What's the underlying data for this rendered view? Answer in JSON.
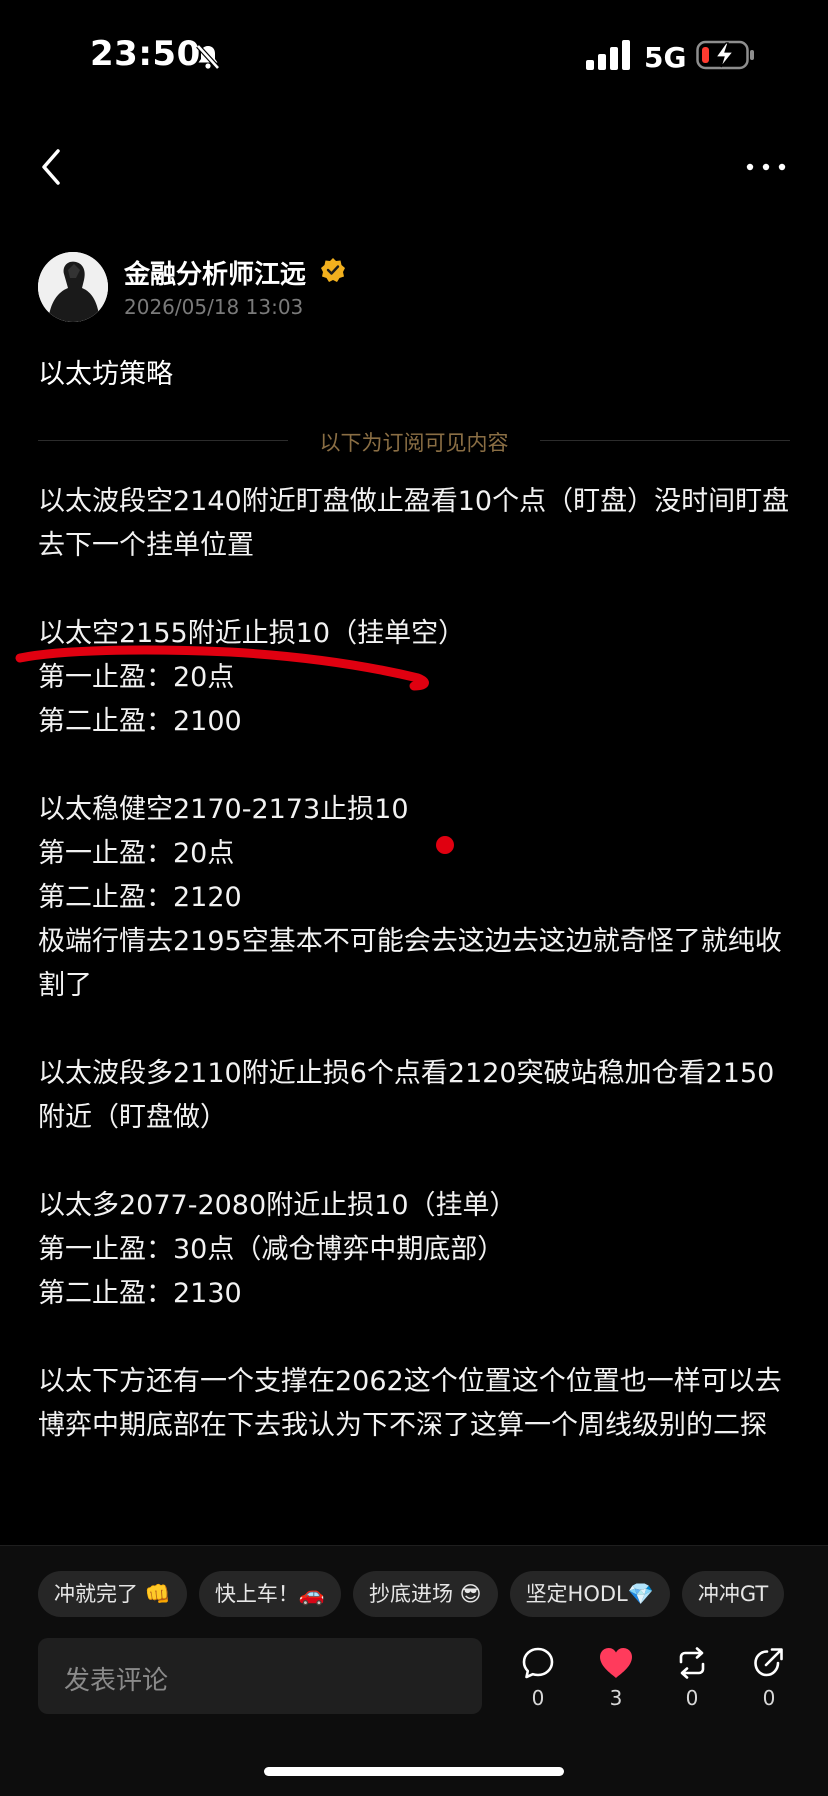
{
  "status_bar": {
    "time": "23:50",
    "network": "5G"
  },
  "post": {
    "author_name": "金融分析师江远",
    "timestamp": "2026/05/18 13:03",
    "title": "以太坊策略",
    "subscriber_divider": "以下为订阅可见内容",
    "paragraphs": [
      [
        "以太波段空2140附近盯盘做止盈看10个点（盯盘）没时间盯盘去下一个挂单位置"
      ],
      [
        "以太空2155附近止损10（挂单空）",
        "第一止盈：20点",
        "第二止盈：2100"
      ],
      [
        "以太稳健空2170-2173止损10",
        "第一止盈：20点",
        "第二止盈：2120",
        "极端行情去2195空基本不可能会去这边去这边就奇怪了就纯收割了"
      ],
      [
        "以太波段多2110附近止损6个点看2120突破站稳加仓看2150附近（盯盘做）"
      ],
      [
        "以太多2077-2080附近止损10（挂单）",
        "第一止盈：30点（减仓博弈中期底部）",
        "第二止盈：2130"
      ],
      [
        "以太下方还有一个支撑在2062这个位置这个位置也一样可以去博弈中期底部在下去我认为下不深了这算一个周线级别的二探"
      ]
    ]
  },
  "quick_replies": [
    "冲就完了 👊",
    "快上车！🚗",
    "抄底进场 😎",
    "坚定HODL💎",
    "冲冲GT"
  ],
  "comment_box": {
    "placeholder": "发表评论"
  },
  "actions": {
    "comment_count": "0",
    "like_count": "3",
    "repost_count": "0",
    "share_count": "0"
  },
  "colors": {
    "accent_like": "#ff3b5c",
    "verified": "#f2b01e",
    "annotation_red": "#e00010"
  }
}
